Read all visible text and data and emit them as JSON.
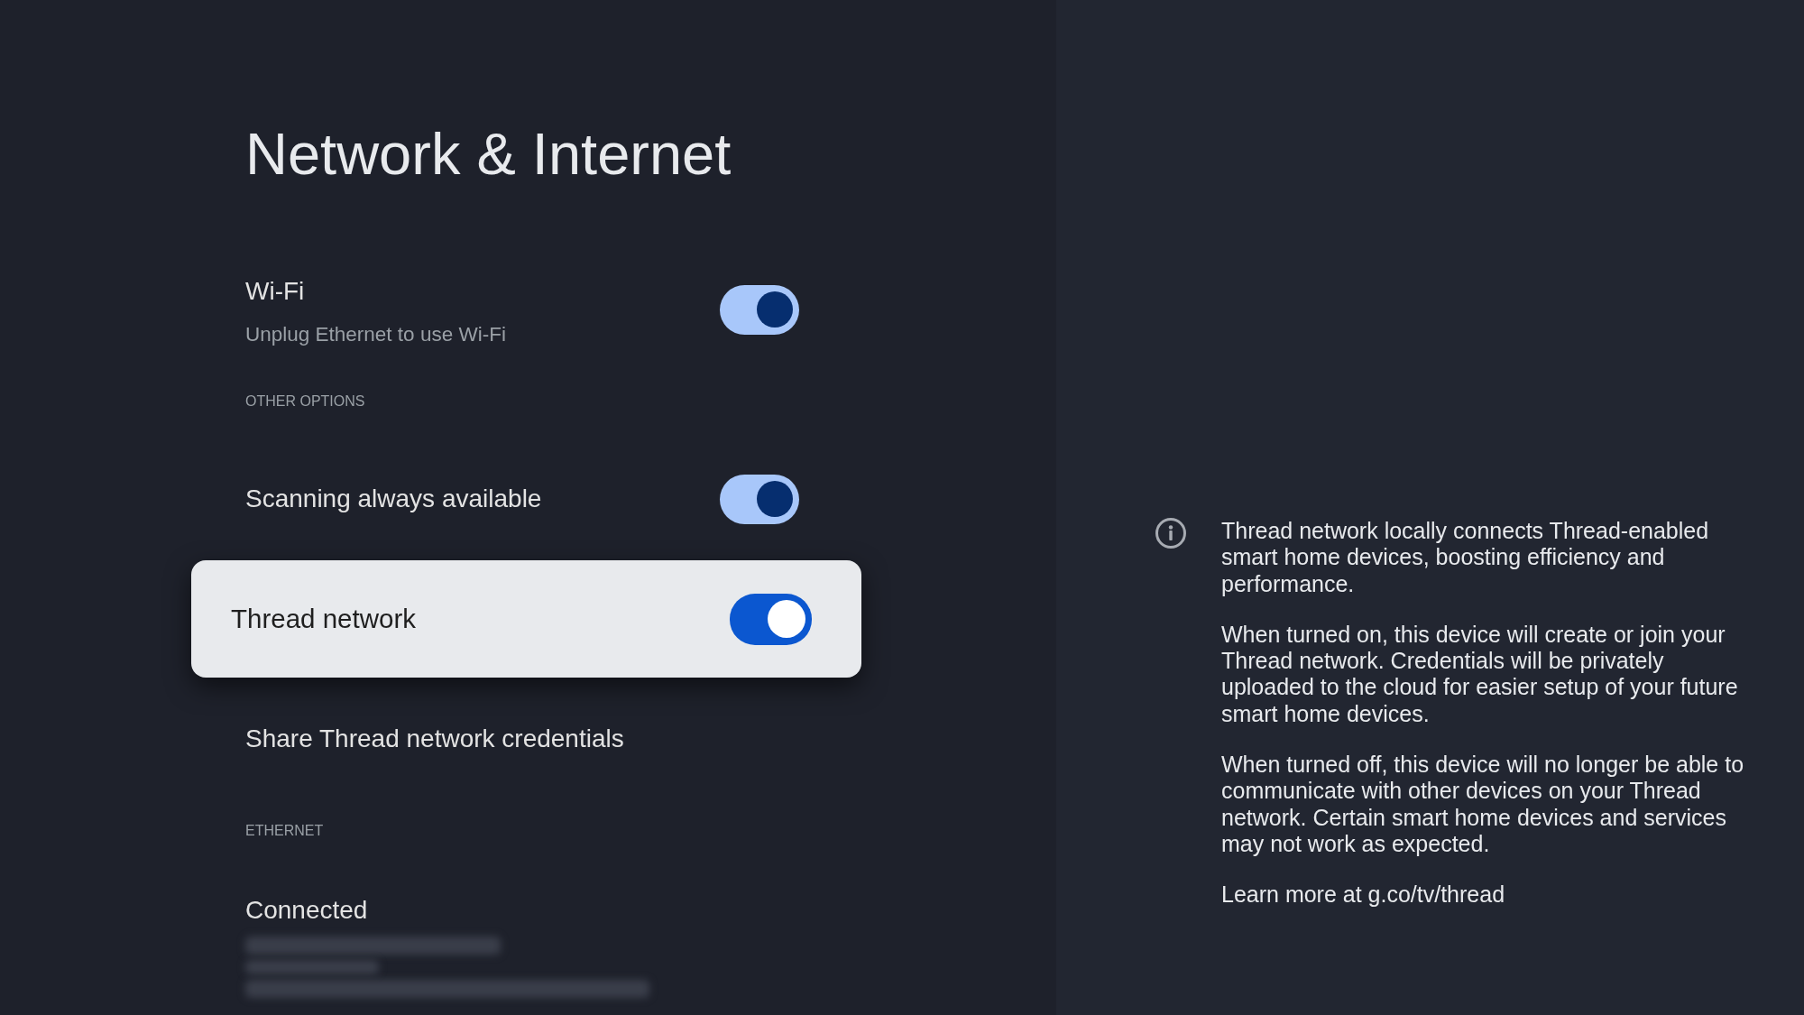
{
  "page_title": "Network & Internet",
  "settings": [
    {
      "kind": "toggle",
      "label": "Wi-Fi",
      "summary": "Unplug Ethernet to use Wi-Fi",
      "on": true,
      "selected": false
    },
    {
      "kind": "header",
      "label": "OTHER OPTIONS"
    },
    {
      "kind": "toggle",
      "label": "Scanning always available",
      "on": true,
      "selected": false
    },
    {
      "kind": "toggle",
      "label": "Thread network",
      "on": true,
      "selected": true
    },
    {
      "kind": "action",
      "label": "Share Thread network credentials",
      "selected": false
    },
    {
      "kind": "header",
      "label": "ETHERNET"
    },
    {
      "kind": "status",
      "label": "Connected",
      "details_blurred": true,
      "selected": false
    }
  ],
  "info_panel": {
    "paragraphs": [
      "Thread network locally connects Thread-enabled smart home devices, boosting efficiency and performance.",
      "When turned on, this device will create or join your Thread network. Credentials will be privately uploaded to the cloud for easier setup of your future smart home devices.",
      "When turned off, this device will no longer be able to communicate with other devices on your Thread network. Certain smart home devices and services may not work as expected.",
      "Learn more at g.co/tv/thread"
    ]
  }
}
